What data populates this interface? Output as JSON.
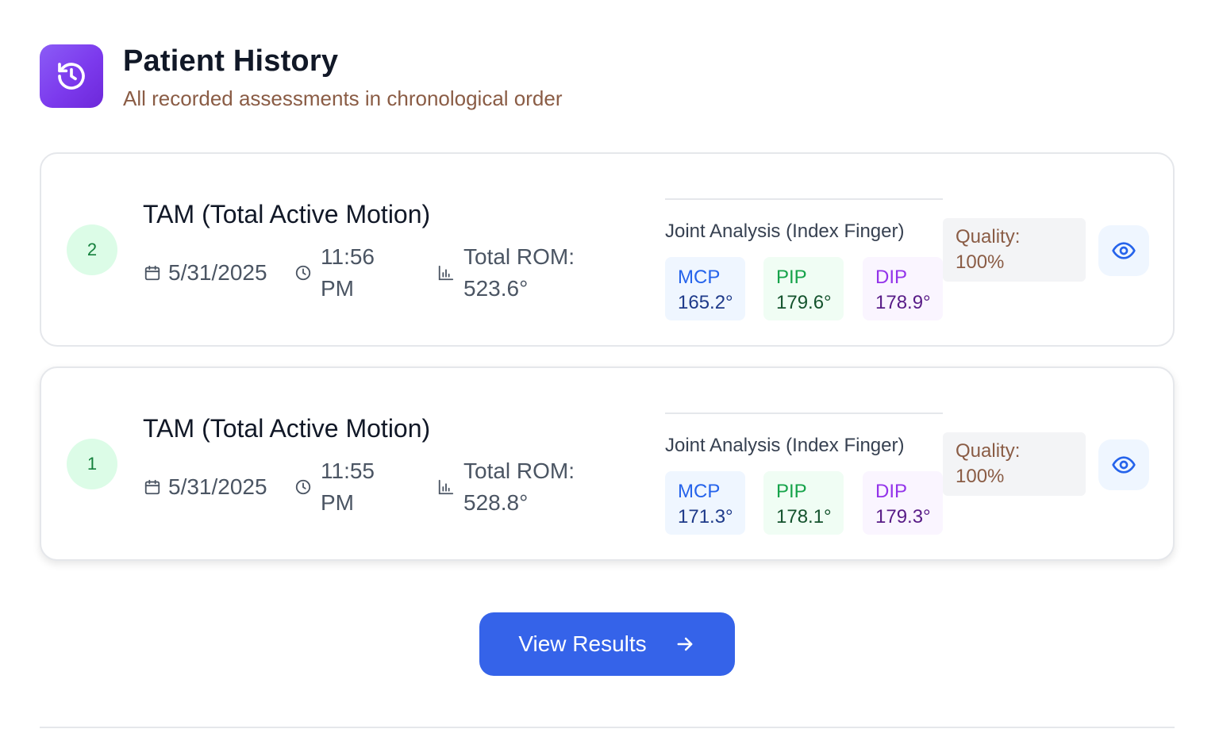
{
  "header": {
    "title": "Patient History",
    "subtitle": "All recorded assessments in chronological order",
    "icon": "history-icon"
  },
  "assessments": [
    {
      "number": "2",
      "title": "TAM (Total Active Motion)",
      "date": "5/31/2025",
      "time_line1": "11:56",
      "time_line2": "PM",
      "rom_line1": "Total ROM:",
      "rom_line2": "523.6°",
      "joint_title": "Joint Analysis (Index Finger)",
      "joints": [
        {
          "label": "MCP",
          "value": "165.2°"
        },
        {
          "label": "PIP",
          "value": "179.6°"
        },
        {
          "label": "DIP",
          "value": "178.9°"
        }
      ],
      "quality_label": "Quality:",
      "quality_value": "100%"
    },
    {
      "number": "1",
      "title": "TAM (Total Active Motion)",
      "date": "5/31/2025",
      "time_line1": "11:55",
      "time_line2": "PM",
      "rom_line1": "Total ROM:",
      "rom_line2": "528.8°",
      "joint_title": "Joint Analysis (Index Finger)",
      "joints": [
        {
          "label": "MCP",
          "value": "171.3°"
        },
        {
          "label": "PIP",
          "value": "178.1°"
        },
        {
          "label": "DIP",
          "value": "179.3°"
        }
      ],
      "quality_label": "Quality:",
      "quality_value": "100%"
    }
  ],
  "actions": {
    "view_results_label": "View Results"
  },
  "colors": {
    "accent": "#3563e9",
    "header_icon": "#7c3aed",
    "subtitle": "#8a5c45"
  }
}
